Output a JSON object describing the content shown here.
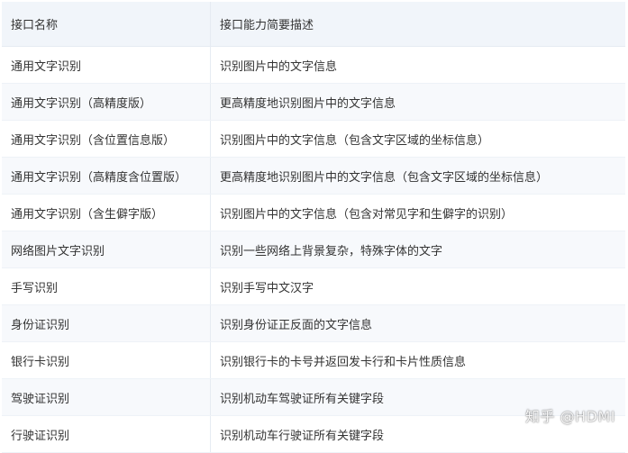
{
  "table": {
    "headers": [
      "接口名称",
      "接口能力简要描述"
    ],
    "rows": [
      {
        "name": "通用文字识别",
        "desc": "识别图片中的文字信息"
      },
      {
        "name": "通用文字识别（高精度版）",
        "desc": "更高精度地识别图片中的文字信息"
      },
      {
        "name": "通用文字识别（含位置信息版）",
        "desc": "识别图片中的文字信息（包含文字区域的坐标信息）"
      },
      {
        "name": "通用文字识别（高精度含位置版）",
        "desc": "更高精度地识别图片中的文字信息（包含文字区域的坐标信息）"
      },
      {
        "name": "通用文字识别（含生僻字版）",
        "desc": "识别图片中的文字信息（包含对常见字和生僻字的识别）"
      },
      {
        "name": "网络图片文字识别",
        "desc": "识别一些网络上背景复杂，特殊字体的文字"
      },
      {
        "name": "手写识别",
        "desc": "识别手写中文汉字"
      },
      {
        "name": "身份证识别",
        "desc": "识别身份证正反面的文字信息"
      },
      {
        "name": "银行卡识别",
        "desc": "识别银行卡的卡号并返回发卡行和卡片性质信息"
      },
      {
        "name": "驾驶证识别",
        "desc": "识别机动车驾驶证所有关键字段"
      },
      {
        "name": "行驶证识别",
        "desc": "识别机动车行驶证所有关键字段"
      }
    ]
  },
  "watermark": "知乎 @HDMI"
}
